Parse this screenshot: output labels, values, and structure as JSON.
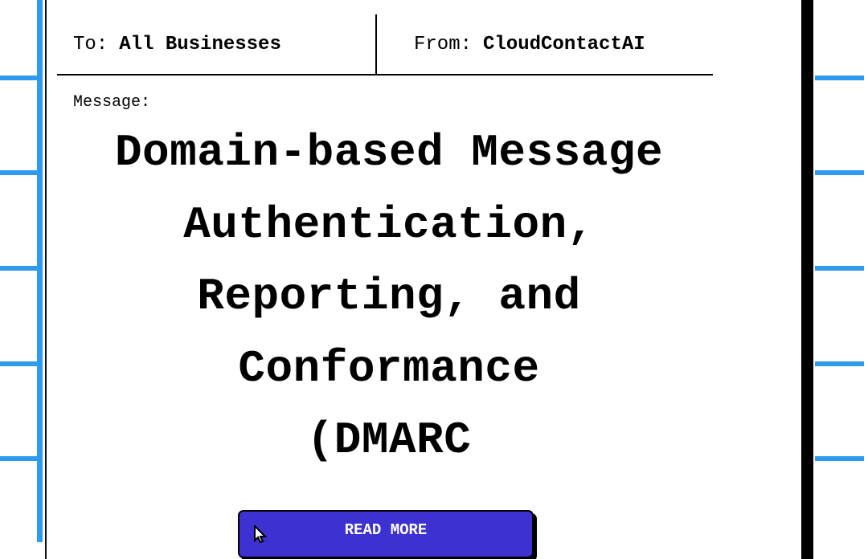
{
  "colors": {
    "grid_line": "#2f9bf0",
    "button_bg": "#3e31d1",
    "button_text": "#ffffff",
    "border": "#000000"
  },
  "header": {
    "to_label": "To:",
    "to_value": "All Businesses",
    "from_label": "From:",
    "from_value": "CloudContactAI"
  },
  "message": {
    "label": "Message:",
    "title_lines": [
      "Domain-based Message",
      "Authentication,",
      "Reporting, and",
      "Conformance",
      "(DMARC"
    ]
  },
  "cta": {
    "label": "READ MORE",
    "icon": "pointer-cursor-icon"
  }
}
